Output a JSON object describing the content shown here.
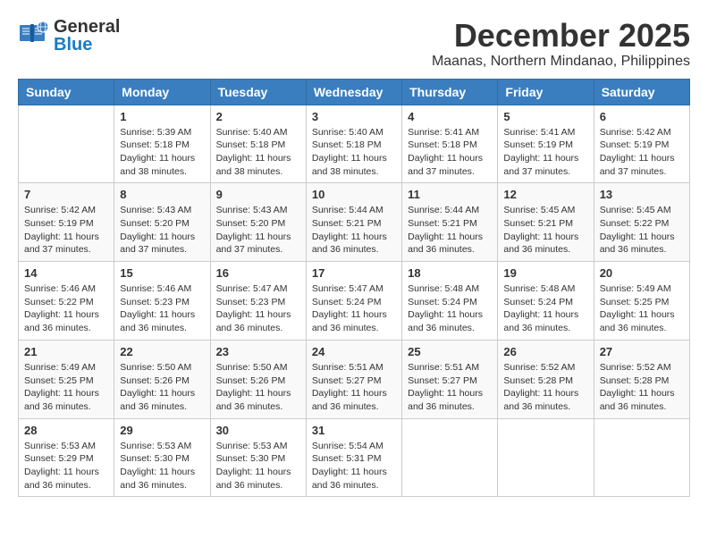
{
  "logo": {
    "general": "General",
    "blue": "Blue"
  },
  "title": {
    "month": "December 2025",
    "location": "Maanas, Northern Mindanao, Philippines"
  },
  "headers": [
    "Sunday",
    "Monday",
    "Tuesday",
    "Wednesday",
    "Thursday",
    "Friday",
    "Saturday"
  ],
  "weeks": [
    [
      {
        "day": "",
        "sunrise": "",
        "sunset": "",
        "daylight": ""
      },
      {
        "day": "1",
        "sunrise": "Sunrise: 5:39 AM",
        "sunset": "Sunset: 5:18 PM",
        "daylight": "Daylight: 11 hours and 38 minutes."
      },
      {
        "day": "2",
        "sunrise": "Sunrise: 5:40 AM",
        "sunset": "Sunset: 5:18 PM",
        "daylight": "Daylight: 11 hours and 38 minutes."
      },
      {
        "day": "3",
        "sunrise": "Sunrise: 5:40 AM",
        "sunset": "Sunset: 5:18 PM",
        "daylight": "Daylight: 11 hours and 38 minutes."
      },
      {
        "day": "4",
        "sunrise": "Sunrise: 5:41 AM",
        "sunset": "Sunset: 5:18 PM",
        "daylight": "Daylight: 11 hours and 37 minutes."
      },
      {
        "day": "5",
        "sunrise": "Sunrise: 5:41 AM",
        "sunset": "Sunset: 5:19 PM",
        "daylight": "Daylight: 11 hours and 37 minutes."
      },
      {
        "day": "6",
        "sunrise": "Sunrise: 5:42 AM",
        "sunset": "Sunset: 5:19 PM",
        "daylight": "Daylight: 11 hours and 37 minutes."
      }
    ],
    [
      {
        "day": "7",
        "sunrise": "Sunrise: 5:42 AM",
        "sunset": "Sunset: 5:19 PM",
        "daylight": "Daylight: 11 hours and 37 minutes."
      },
      {
        "day": "8",
        "sunrise": "Sunrise: 5:43 AM",
        "sunset": "Sunset: 5:20 PM",
        "daylight": "Daylight: 11 hours and 37 minutes."
      },
      {
        "day": "9",
        "sunrise": "Sunrise: 5:43 AM",
        "sunset": "Sunset: 5:20 PM",
        "daylight": "Daylight: 11 hours and 37 minutes."
      },
      {
        "day": "10",
        "sunrise": "Sunrise: 5:44 AM",
        "sunset": "Sunset: 5:21 PM",
        "daylight": "Daylight: 11 hours and 36 minutes."
      },
      {
        "day": "11",
        "sunrise": "Sunrise: 5:44 AM",
        "sunset": "Sunset: 5:21 PM",
        "daylight": "Daylight: 11 hours and 36 minutes."
      },
      {
        "day": "12",
        "sunrise": "Sunrise: 5:45 AM",
        "sunset": "Sunset: 5:21 PM",
        "daylight": "Daylight: 11 hours and 36 minutes."
      },
      {
        "day": "13",
        "sunrise": "Sunrise: 5:45 AM",
        "sunset": "Sunset: 5:22 PM",
        "daylight": "Daylight: 11 hours and 36 minutes."
      }
    ],
    [
      {
        "day": "14",
        "sunrise": "Sunrise: 5:46 AM",
        "sunset": "Sunset: 5:22 PM",
        "daylight": "Daylight: 11 hours and 36 minutes."
      },
      {
        "day": "15",
        "sunrise": "Sunrise: 5:46 AM",
        "sunset": "Sunset: 5:23 PM",
        "daylight": "Daylight: 11 hours and 36 minutes."
      },
      {
        "day": "16",
        "sunrise": "Sunrise: 5:47 AM",
        "sunset": "Sunset: 5:23 PM",
        "daylight": "Daylight: 11 hours and 36 minutes."
      },
      {
        "day": "17",
        "sunrise": "Sunrise: 5:47 AM",
        "sunset": "Sunset: 5:24 PM",
        "daylight": "Daylight: 11 hours and 36 minutes."
      },
      {
        "day": "18",
        "sunrise": "Sunrise: 5:48 AM",
        "sunset": "Sunset: 5:24 PM",
        "daylight": "Daylight: 11 hours and 36 minutes."
      },
      {
        "day": "19",
        "sunrise": "Sunrise: 5:48 AM",
        "sunset": "Sunset: 5:24 PM",
        "daylight": "Daylight: 11 hours and 36 minutes."
      },
      {
        "day": "20",
        "sunrise": "Sunrise: 5:49 AM",
        "sunset": "Sunset: 5:25 PM",
        "daylight": "Daylight: 11 hours and 36 minutes."
      }
    ],
    [
      {
        "day": "21",
        "sunrise": "Sunrise: 5:49 AM",
        "sunset": "Sunset: 5:25 PM",
        "daylight": "Daylight: 11 hours and 36 minutes."
      },
      {
        "day": "22",
        "sunrise": "Sunrise: 5:50 AM",
        "sunset": "Sunset: 5:26 PM",
        "daylight": "Daylight: 11 hours and 36 minutes."
      },
      {
        "day": "23",
        "sunrise": "Sunrise: 5:50 AM",
        "sunset": "Sunset: 5:26 PM",
        "daylight": "Daylight: 11 hours and 36 minutes."
      },
      {
        "day": "24",
        "sunrise": "Sunrise: 5:51 AM",
        "sunset": "Sunset: 5:27 PM",
        "daylight": "Daylight: 11 hours and 36 minutes."
      },
      {
        "day": "25",
        "sunrise": "Sunrise: 5:51 AM",
        "sunset": "Sunset: 5:27 PM",
        "daylight": "Daylight: 11 hours and 36 minutes."
      },
      {
        "day": "26",
        "sunrise": "Sunrise: 5:52 AM",
        "sunset": "Sunset: 5:28 PM",
        "daylight": "Daylight: 11 hours and 36 minutes."
      },
      {
        "day": "27",
        "sunrise": "Sunrise: 5:52 AM",
        "sunset": "Sunset: 5:28 PM",
        "daylight": "Daylight: 11 hours and 36 minutes."
      }
    ],
    [
      {
        "day": "28",
        "sunrise": "Sunrise: 5:53 AM",
        "sunset": "Sunset: 5:29 PM",
        "daylight": "Daylight: 11 hours and 36 minutes."
      },
      {
        "day": "29",
        "sunrise": "Sunrise: 5:53 AM",
        "sunset": "Sunset: 5:30 PM",
        "daylight": "Daylight: 11 hours and 36 minutes."
      },
      {
        "day": "30",
        "sunrise": "Sunrise: 5:53 AM",
        "sunset": "Sunset: 5:30 PM",
        "daylight": "Daylight: 11 hours and 36 minutes."
      },
      {
        "day": "31",
        "sunrise": "Sunrise: 5:54 AM",
        "sunset": "Sunset: 5:31 PM",
        "daylight": "Daylight: 11 hours and 36 minutes."
      },
      {
        "day": "",
        "sunrise": "",
        "sunset": "",
        "daylight": ""
      },
      {
        "day": "",
        "sunrise": "",
        "sunset": "",
        "daylight": ""
      },
      {
        "day": "",
        "sunrise": "",
        "sunset": "",
        "daylight": ""
      }
    ]
  ]
}
